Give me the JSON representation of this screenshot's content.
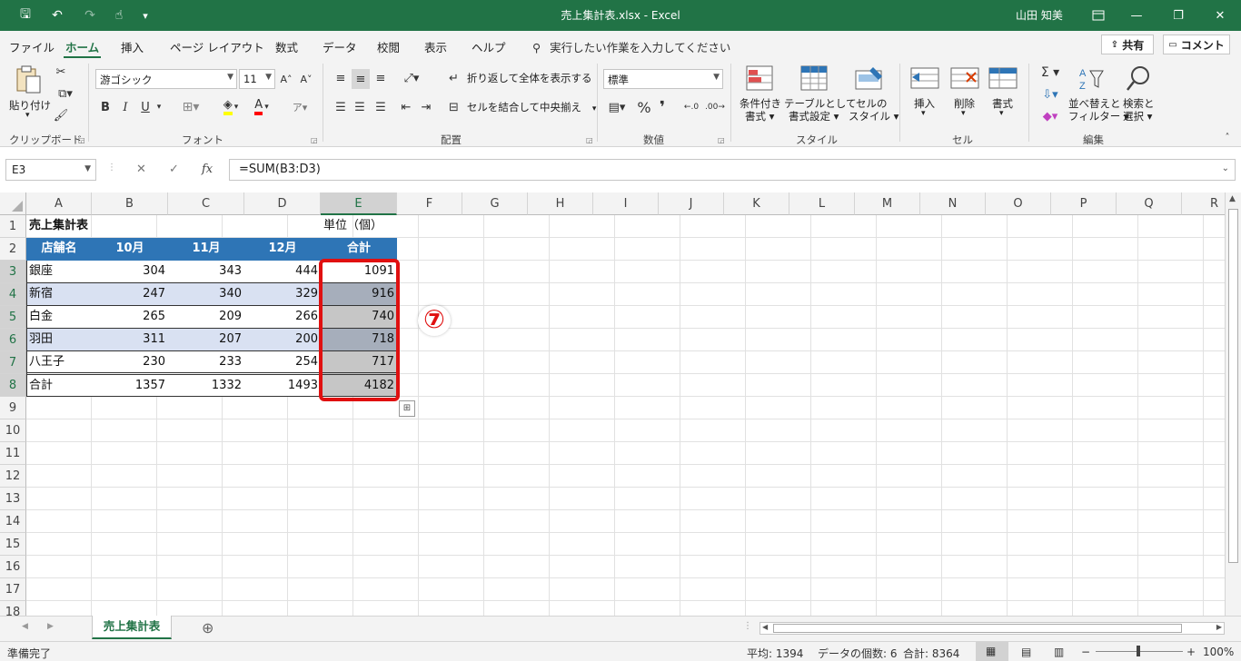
{
  "window": {
    "title": "売上集計表.xlsx  -  Excel",
    "user": "山田 知美",
    "minimize": "—",
    "restore": "❐",
    "close": "✕"
  },
  "quick_access": {
    "save": "🖫",
    "undo": "↶",
    "redo": "↷",
    "touch": "☝",
    "more": "▾",
    "customize": "⇣"
  },
  "menu": {
    "tabs": [
      "ファイル",
      "ホーム",
      "挿入",
      "ページ レイアウト",
      "数式",
      "データ",
      "校閲",
      "表示",
      "ヘルプ"
    ],
    "active_tab": "ホーム",
    "tellme": "実行したい作業を入力してください",
    "share": "共有",
    "comment": "コメント"
  },
  "ribbon": {
    "clipboard": {
      "paste": "貼り付け",
      "label": "クリップボード"
    },
    "font": {
      "name": "游ゴシック",
      "size": "11",
      "label": "フォント",
      "bold": "B",
      "italic": "I",
      "underline": "U"
    },
    "alignment": {
      "wrap": "折り返して全体を表示する",
      "merge": "セルを結合して中央揃え",
      "label": "配置"
    },
    "number": {
      "format": "標準",
      "percent": "%",
      "comma": "❜",
      "label": "数値"
    },
    "styles": {
      "conditional": [
        "条件付き",
        "書式 ▾"
      ],
      "table": [
        "テーブルとして",
        "書式設定 ▾"
      ],
      "cell": [
        "セルの",
        "スタイル ▾"
      ],
      "label": "スタイル"
    },
    "cells": {
      "insert": "挿入",
      "delete": "削除",
      "format": "書式",
      "label": "セル"
    },
    "editing": {
      "sum": "Σ ▾",
      "sort": [
        "並べ替えと",
        "フィルター ▾"
      ],
      "find": [
        "検索と",
        "選択 ▾"
      ],
      "label": "編集"
    }
  },
  "formula_bar": {
    "name_box": "E3",
    "cancel": "✕",
    "enter": "✓",
    "fx": "fx",
    "formula": "=SUM(B3:D3)"
  },
  "sheet": {
    "columns": [
      "A",
      "B",
      "C",
      "D",
      "E",
      "F",
      "G",
      "H",
      "I",
      "J",
      "K",
      "L",
      "M",
      "N",
      "O",
      "P",
      "Q",
      "R"
    ],
    "rows": [
      "1",
      "2",
      "3",
      "4",
      "5",
      "6",
      "7",
      "8",
      "9",
      "10",
      "11",
      "12",
      "13",
      "14",
      "15",
      "16",
      "17",
      "18"
    ],
    "title": "売上集計表",
    "unit": "単位（個）",
    "headers": [
      "店舗名",
      "10月",
      "11月",
      "12月",
      "合計"
    ],
    "data": [
      [
        "銀座",
        "304",
        "343",
        "444",
        "1091"
      ],
      [
        "新宿",
        "247",
        "340",
        "329",
        "916"
      ],
      [
        "白金",
        "265",
        "209",
        "266",
        "740"
      ],
      [
        "羽田",
        "311",
        "207",
        "200",
        "718"
      ],
      [
        "八王子",
        "230",
        "233",
        "254",
        "717"
      ],
      [
        "合計",
        "1357",
        "1332",
        "1493",
        "4182"
      ]
    ],
    "annotation": "⑦"
  },
  "sheet_tabs": {
    "active": "売上集計表",
    "add": "⊕"
  },
  "status": {
    "ready": "準備完了",
    "average": "平均: 1394",
    "count": "データの個数: 6",
    "sum": "合計: 8364",
    "zoom": "100%"
  },
  "colors": {
    "accent": "#217346",
    "header_fill": "#2e75b6",
    "band_fill": "#d9e1f2",
    "highlight": "#e01010"
  }
}
